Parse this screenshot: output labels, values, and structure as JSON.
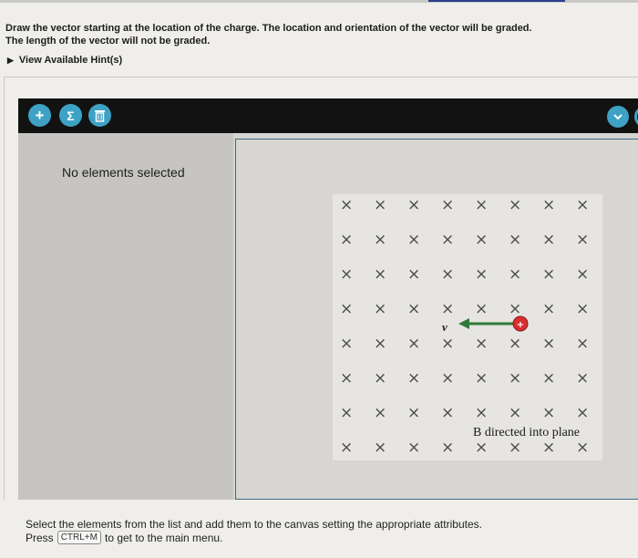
{
  "instruction": {
    "line1": "Draw the vector starting at the location of the charge. The location and orientation of the vector will be graded.",
    "line2": "The length of the vector will not be graded."
  },
  "hint": {
    "label": "View Available Hint(s)"
  },
  "toolbar": {
    "add_icon": "plus-icon",
    "sigma_icon": "sigma-icon",
    "trash_icon": "trash-icon",
    "add_glyph": "+",
    "sigma_glyph": "Σ",
    "caret_glyph": "✓"
  },
  "side_panel": {
    "message": "No elements selected"
  },
  "figure": {
    "rows": 8,
    "cols": 8,
    "field_symbol": "×",
    "velocity_label": "v",
    "caption": "B directed into plane",
    "charge_sign": "+",
    "charge_color": "#d8302e",
    "arrow_color": "#2f7a3a"
  },
  "footer": {
    "line1": "Select the elements from the list and add them to the canvas setting the appropriate attributes.",
    "press": "Press",
    "shortcut": "CTRL+M",
    "rest": "to get to the main menu."
  },
  "colors": {
    "accent": "#3ea2c4",
    "toolbar_bg": "#121212",
    "panel_bg": "#c6c5c2"
  }
}
